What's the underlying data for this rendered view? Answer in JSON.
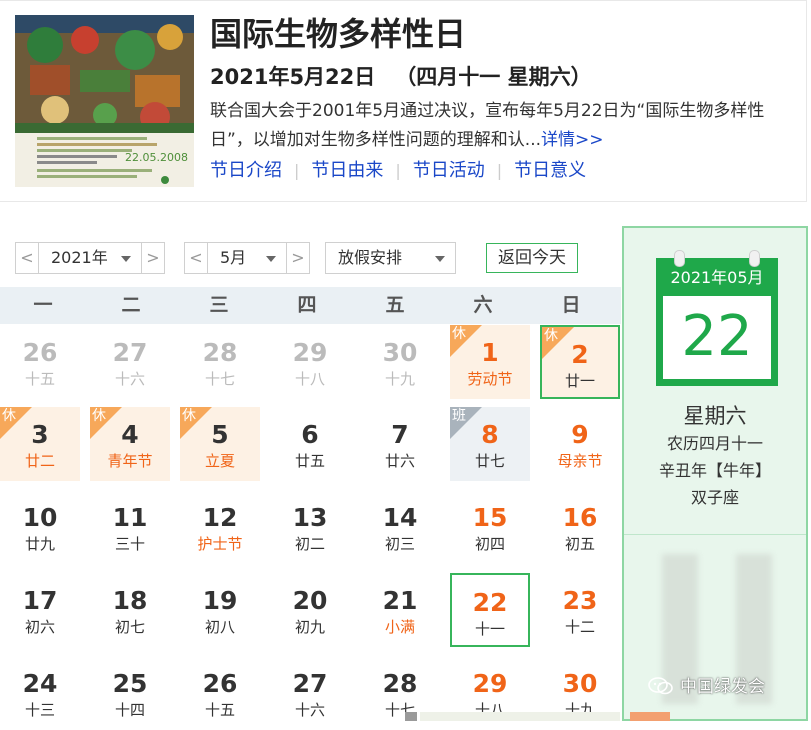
{
  "event": {
    "title": "国际生物多样性日",
    "date_line": "2021年5月22日",
    "lunar_line": "（四月十一 星期六）",
    "description": "联合国大会于2001年5月通过决议，宣布每年5月22日为“国际生物多样性日”，以增加对生物多样性问题的理解和认...",
    "more_link": "详情>>",
    "links": [
      "节日介绍",
      "节日由来",
      "节日活动",
      "节日意义"
    ],
    "poster_date": "22.05.2008"
  },
  "controls": {
    "prev_arrow": "<",
    "next_arrow": ">",
    "year_value": "2021年",
    "month_value": "5月",
    "holiday_value": "放假安排",
    "today_button": "返回今天"
  },
  "weekdays": [
    "一",
    "二",
    "三",
    "四",
    "五",
    "六",
    "日"
  ],
  "rows": [
    [
      {
        "n": "26",
        "s": "十五",
        "type": "dim"
      },
      {
        "n": "27",
        "s": "十六",
        "type": "dim"
      },
      {
        "n": "28",
        "s": "十七",
        "type": "dim"
      },
      {
        "n": "29",
        "s": "十八",
        "type": "dim"
      },
      {
        "n": "30",
        "s": "十九",
        "type": "dim"
      },
      {
        "n": "1",
        "s": "劳动节",
        "type": "rest",
        "tag": "休"
      },
      {
        "n": "2",
        "s": "廿一",
        "type": "rest",
        "tag": "休",
        "outline": true
      }
    ],
    [
      {
        "n": "3",
        "s": "廿二",
        "type": "rest",
        "tag": "休"
      },
      {
        "n": "4",
        "s": "青年节",
        "type": "rest",
        "tag": "休"
      },
      {
        "n": "5",
        "s": "立夏",
        "type": "rest",
        "tag": "休"
      },
      {
        "n": "6",
        "s": "廿五",
        "type": "normal"
      },
      {
        "n": "7",
        "s": "廿六",
        "type": "normal"
      },
      {
        "n": "8",
        "s": "廿七",
        "type": "work",
        "tag": "班"
      },
      {
        "n": "9",
        "s": "母亲节",
        "type": "weekend",
        "fest": true
      }
    ],
    [
      {
        "n": "10",
        "s": "廿九",
        "type": "normal"
      },
      {
        "n": "11",
        "s": "三十",
        "type": "normal"
      },
      {
        "n": "12",
        "s": "护士节",
        "type": "normal",
        "fest": true
      },
      {
        "n": "13",
        "s": "初二",
        "type": "normal"
      },
      {
        "n": "14",
        "s": "初三",
        "type": "normal"
      },
      {
        "n": "15",
        "s": "初四",
        "type": "weekend"
      },
      {
        "n": "16",
        "s": "初五",
        "type": "weekend"
      }
    ],
    [
      {
        "n": "17",
        "s": "初六",
        "type": "normal"
      },
      {
        "n": "18",
        "s": "初七",
        "type": "normal"
      },
      {
        "n": "19",
        "s": "初八",
        "type": "normal"
      },
      {
        "n": "20",
        "s": "初九",
        "type": "normal"
      },
      {
        "n": "21",
        "s": "小满",
        "type": "normal",
        "fest": true
      },
      {
        "n": "22",
        "s": "十一",
        "type": "weekend",
        "today": true
      },
      {
        "n": "23",
        "s": "十二",
        "type": "weekend"
      }
    ],
    [
      {
        "n": "24",
        "s": "十三",
        "type": "normal"
      },
      {
        "n": "25",
        "s": "十四",
        "type": "normal"
      },
      {
        "n": "26",
        "s": "十五",
        "type": "normal"
      },
      {
        "n": "27",
        "s": "十六",
        "type": "normal"
      },
      {
        "n": "28",
        "s": "十七",
        "type": "normal"
      },
      {
        "n": "29",
        "s": "十八",
        "type": "weekend"
      },
      {
        "n": "30",
        "s": "十九",
        "type": "weekend"
      }
    ]
  ],
  "side": {
    "month_header": "2021年05月",
    "day": "22",
    "weekday": "星期六",
    "lunar": "农历四月十一",
    "ganzhi": "辛丑年【牛年】",
    "zodiac": "双子座"
  },
  "watermark": "中国绿发会",
  "colors": {
    "accent_green": "#37b55b",
    "orange": "#f06418",
    "link_blue": "#1a47c8",
    "rest_bg": "#fdf1e4"
  }
}
